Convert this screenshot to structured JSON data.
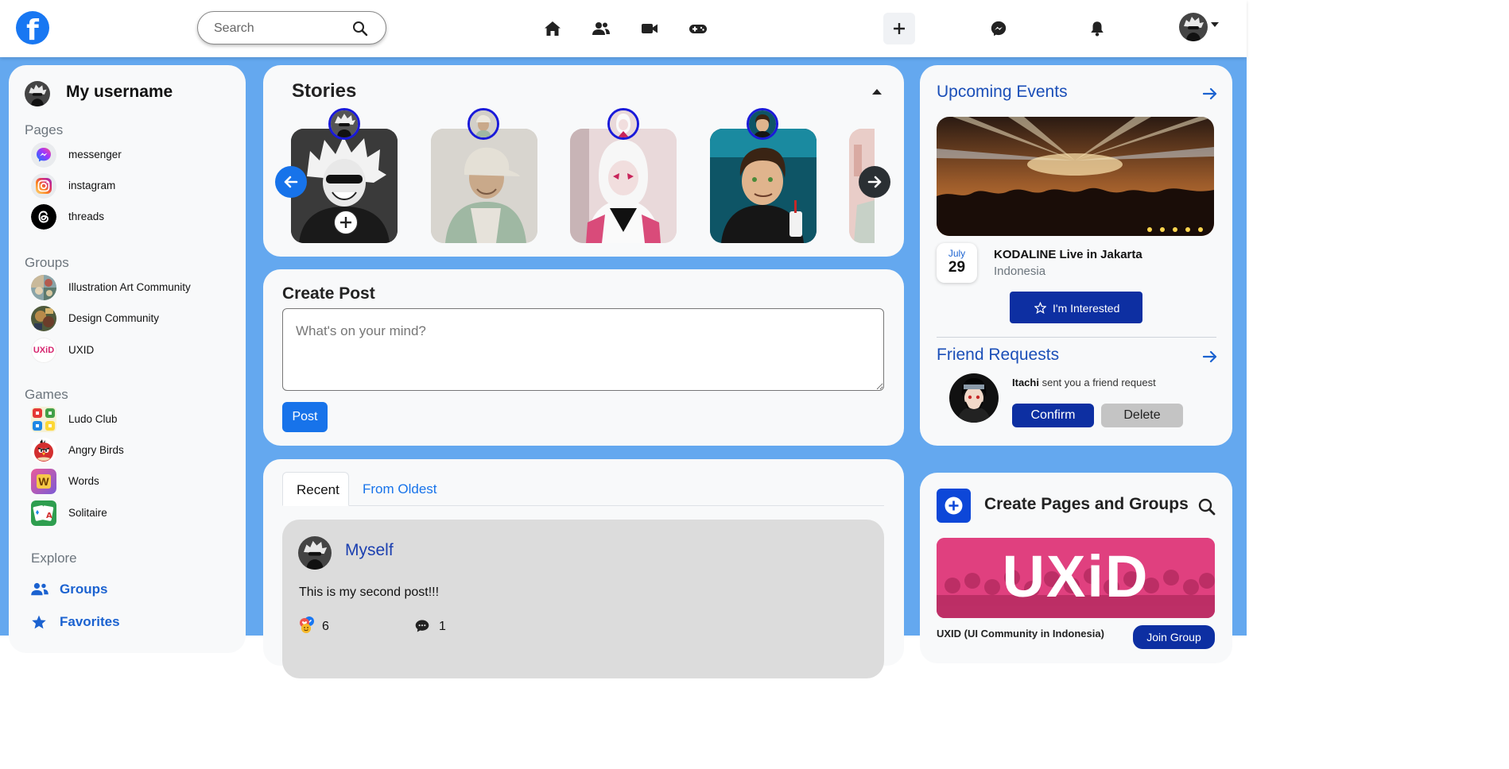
{
  "header": {
    "logo_icon": "facebook-logo-icon",
    "search_placeholder": "Search",
    "nav_icons": [
      "home-icon",
      "friends-icon",
      "video-icon",
      "gaming-icon"
    ],
    "right_icons": [
      "plus-icon",
      "messenger-icon",
      "bell-icon",
      "avatar"
    ]
  },
  "sidebar": {
    "username": "My username",
    "pages_heading": "Pages",
    "pages": [
      {
        "label": "messenger",
        "icon": "messenger-icon"
      },
      {
        "label": "instagram",
        "icon": "instagram-icon"
      },
      {
        "label": "threads",
        "icon": "threads-icon"
      }
    ],
    "groups_heading": "Groups",
    "groups": [
      {
        "label": "Illustration Art Community"
      },
      {
        "label": "Design Community"
      },
      {
        "label": "UXID",
        "logo_text": "UXiD"
      }
    ],
    "games_heading": "Games",
    "games": [
      {
        "label": "Ludo Club"
      },
      {
        "label": "Angry Birds"
      },
      {
        "label": "Words",
        "logo_text": "W"
      },
      {
        "label": "Solitaire"
      }
    ],
    "explore_heading": "Explore",
    "explore": [
      {
        "label": "Groups",
        "icon": "users-icon"
      },
      {
        "label": "Favorites",
        "icon": "star-icon"
      }
    ]
  },
  "stories": {
    "title": "Stories",
    "count_visible": 5
  },
  "create_post": {
    "title": "Create Post",
    "placeholder": "What's on your mind?",
    "button": "Post"
  },
  "feed": {
    "tabs": [
      "Recent",
      "From Oldest"
    ],
    "active_tab": "Recent",
    "post": {
      "author": "Myself",
      "text": "This is my second post!!!",
      "reactions": "6",
      "comments": "1"
    }
  },
  "events": {
    "title": "Upcoming Events",
    "month": "July",
    "day": "29",
    "event_title": "KODALINE Live in Jakarta",
    "location": "Indonesia",
    "interested_button": "I'm Interested"
  },
  "friend_requests": {
    "title": "Friend Requests",
    "name": "Itachi",
    "message": "sent you a friend request",
    "confirm": "Confirm",
    "delete": "Delete"
  },
  "create_pages": {
    "title": "Create Pages and Groups",
    "banner_text": "UXiD",
    "group_name": "UXID (UI Community in Indonesia)",
    "join_button": "Join Group"
  },
  "colors": {
    "brand": "#1877f2",
    "background": "#64a8ef",
    "card": "#f8f9fa",
    "dark_button": "#0d2fa2",
    "link": "#1b4fb8"
  }
}
